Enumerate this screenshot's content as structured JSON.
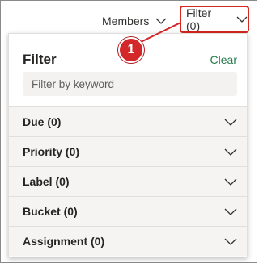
{
  "toolbar": {
    "members_label": "Members",
    "filter_label": "Filter (0)"
  },
  "callout": {
    "number": "1"
  },
  "panel": {
    "title": "Filter",
    "clear_label": "Clear",
    "search_placeholder": "Filter by keyword",
    "sections": [
      {
        "label": "Due (0)"
      },
      {
        "label": "Priority (0)"
      },
      {
        "label": "Label (0)"
      },
      {
        "label": "Bucket (0)"
      },
      {
        "label": "Assignment (0)"
      }
    ]
  },
  "colors": {
    "accent_clear": "#237b4b",
    "callout_red": "#d3272a",
    "highlight_border": "#d6261e"
  },
  "icons": [
    "chevron-down-icon"
  ]
}
